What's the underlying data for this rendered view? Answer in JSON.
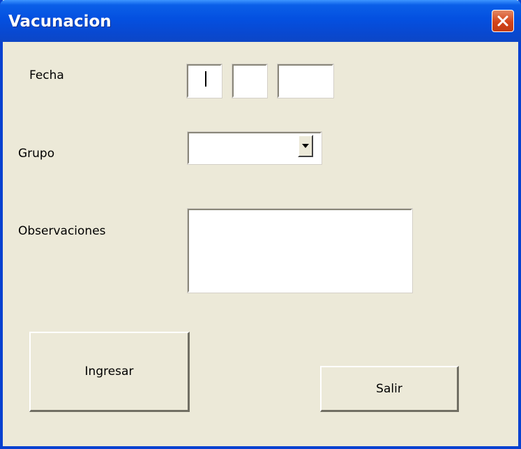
{
  "window": {
    "title": "Vacunacion"
  },
  "form": {
    "fecha_label": "Fecha",
    "fecha_day": "",
    "fecha_month": "",
    "fecha_year": "",
    "grupo_label": "Grupo",
    "grupo_value": "",
    "observaciones_label": "Observaciones",
    "observaciones_value": ""
  },
  "buttons": {
    "ingresar": "Ingresar",
    "salir": "Salir"
  },
  "colors": {
    "titlebar": "#0450e0",
    "window_bg": "#ece9d8",
    "close_button": "#d3441a"
  },
  "icons": {
    "close": "close-icon",
    "dropdown": "chevron-down-icon"
  }
}
